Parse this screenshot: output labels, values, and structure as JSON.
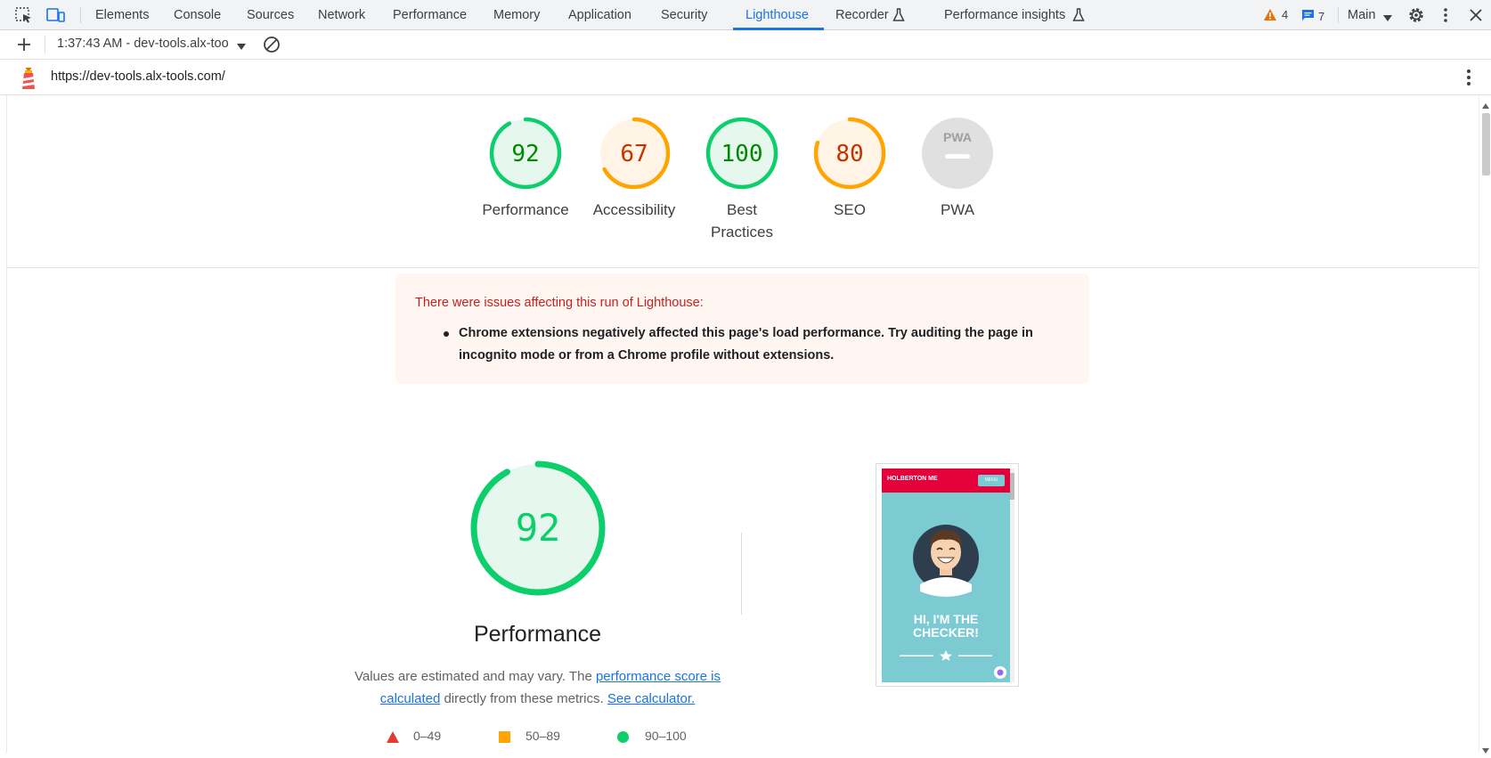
{
  "toolbar": {
    "tabs": [
      "Elements",
      "Console",
      "Sources",
      "Network",
      "Performance",
      "Memory",
      "Application",
      "Security",
      "Lighthouse",
      "Recorder",
      "Performance insights"
    ],
    "active_tab": "Lighthouse",
    "warnings_count": "4",
    "messages_count": "7",
    "context_label": "Main"
  },
  "session": {
    "report_label": "1:37:43 AM - dev-tools.alx-too"
  },
  "url": "https://dev-tools.alx-tools.com/",
  "scores": [
    {
      "label": "Performance",
      "value": "92",
      "fraction": 0.92,
      "status": "pass"
    },
    {
      "label": "Accessibility",
      "value": "67",
      "fraction": 0.67,
      "status": "average"
    },
    {
      "label": "Best Practices",
      "value": "100",
      "fraction": 1.0,
      "status": "pass"
    },
    {
      "label": "SEO",
      "value": "80",
      "fraction": 0.8,
      "status": "average"
    },
    {
      "label": "PWA",
      "value": "",
      "fraction": 0,
      "status": "na"
    }
  ],
  "pwa_badge_text": "PWA",
  "warning": {
    "title": "There were issues affecting this run of Lighthouse:",
    "item": "Chrome extensions negatively affected this page's load performance. Try auditing the page in incognito mode or from a Chrome profile without extensions."
  },
  "performance": {
    "score": "92",
    "fraction": 0.92,
    "title": "Performance",
    "desc_prefix": "Values are estimated and may vary. The ",
    "link1": "performance score is calculated",
    "desc_mid": " directly from these metrics. ",
    "link2": "See calculator."
  },
  "legend": [
    {
      "range": "0–49",
      "shape": "triangle",
      "color": "#e53935"
    },
    {
      "range": "50–89",
      "shape": "square",
      "color": "#ffa400"
    },
    {
      "range": "90–100",
      "shape": "circle",
      "color": "#0cce6b"
    }
  ],
  "screenshot": {
    "brand": "HOLBERTON ME",
    "button": "MENU",
    "hero": "HI, I'M THE CHECKER!"
  },
  "colors": {
    "pass": "#0cce6b",
    "pass_text": "#008800",
    "average": "#ffa400",
    "average_text": "#c33300",
    "accent": "#1a73e8"
  }
}
